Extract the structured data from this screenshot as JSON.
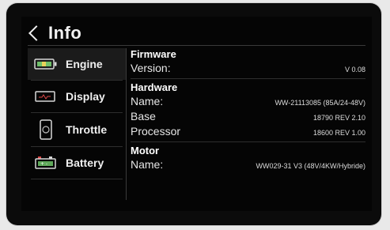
{
  "header": {
    "title": "Info"
  },
  "sidebar": {
    "items": [
      {
        "label": "Engine",
        "icon": "battery-level-icon"
      },
      {
        "label": "Display",
        "icon": "display-icon"
      },
      {
        "label": "Throttle",
        "icon": "throttle-icon"
      },
      {
        "label": "Battery",
        "icon": "battery-terminals-icon"
      }
    ],
    "active": "Engine"
  },
  "firmware": {
    "title": "Firmware",
    "version_label": "Version:",
    "version_value": "V 0.08"
  },
  "hardware": {
    "title": "Hardware",
    "name_label": "Name:",
    "name_value": "WW-21113085 (85A/24-48V)",
    "base_label": "Base",
    "base_value": "18790 REV 2.10",
    "processor_label": "Processor",
    "processor_value": "18600 REV 1.00"
  },
  "motor": {
    "title": "Motor",
    "name_label": "Name:",
    "name_value": "WW029-31 V3 (48V/4KW/Hybride)"
  },
  "colors": {
    "background": "#050505",
    "text": "#e9e9e9",
    "accent_green": "#7fe07a",
    "accent_red": "#e04848"
  }
}
